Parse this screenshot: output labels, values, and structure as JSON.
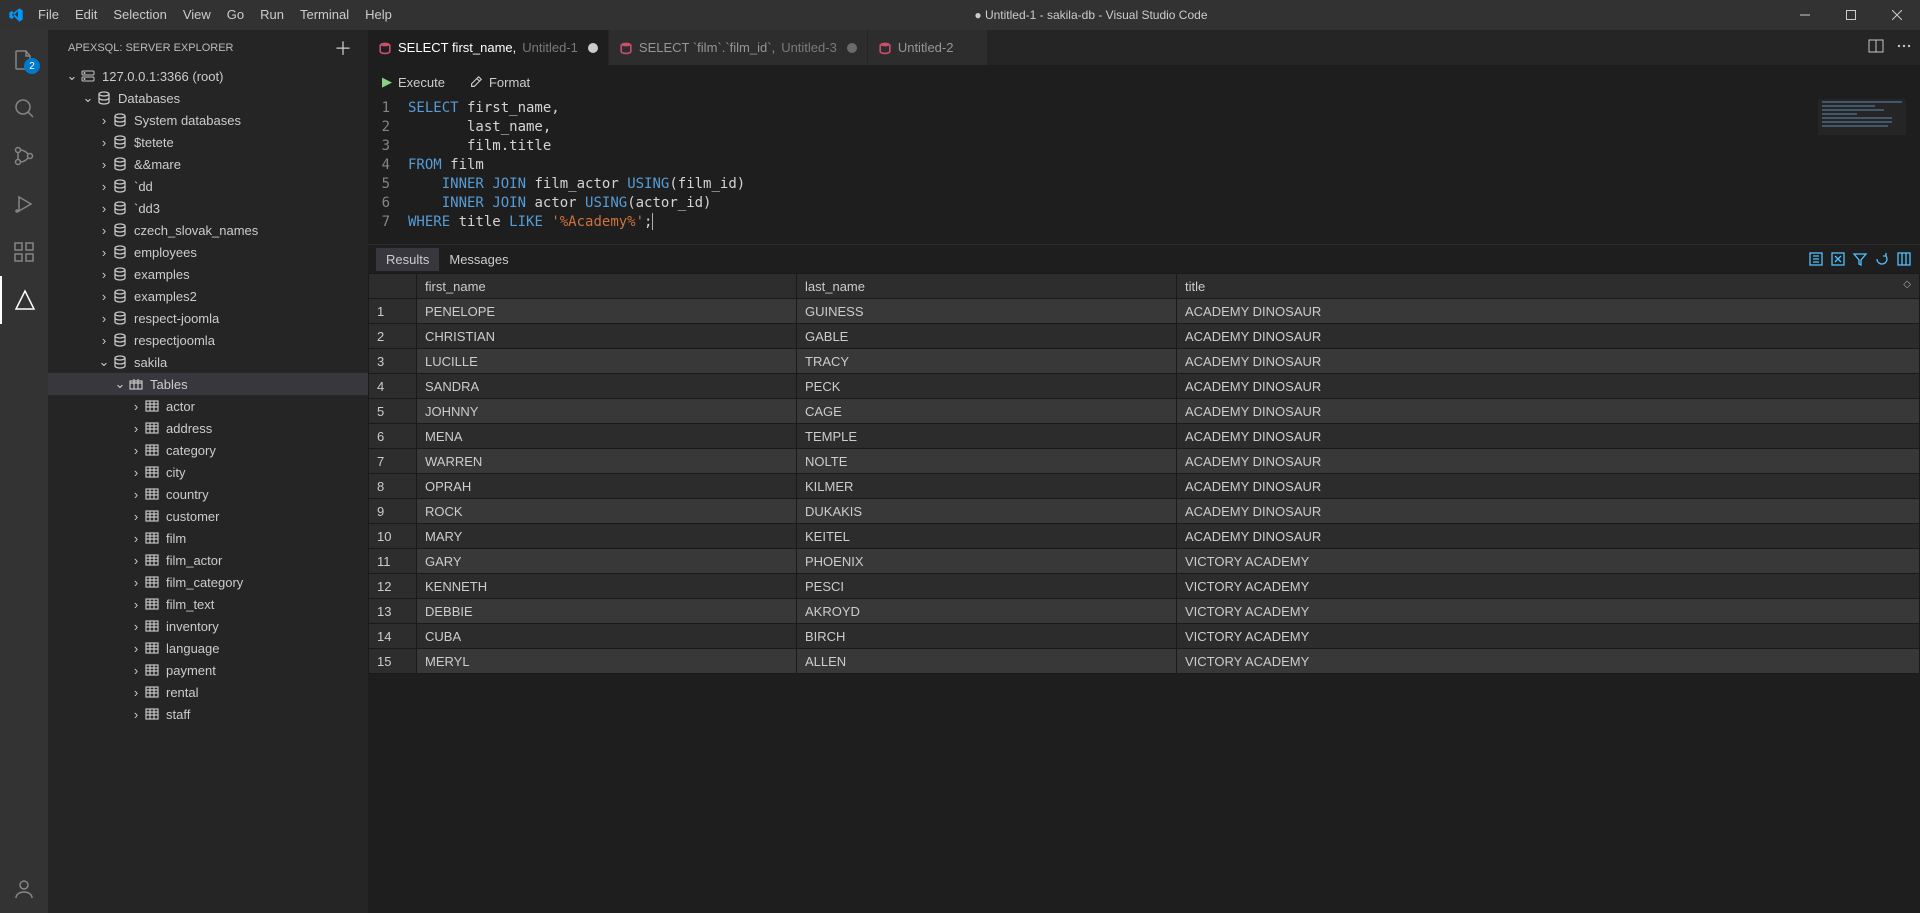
{
  "titlebar": {
    "title": "● Untitled-1 - sakila-db - Visual Studio Code",
    "menus": [
      "File",
      "Edit",
      "Selection",
      "View",
      "Go",
      "Run",
      "Terminal",
      "Help"
    ]
  },
  "activity": {
    "explorer_badge": "2"
  },
  "sidebar": {
    "header": "APEXSQL: SERVER EXPLORER",
    "server": "127.0.0.1:3366 (root)",
    "databases_label": "Databases",
    "system_db_label": "System databases",
    "db_list": [
      "$tetete",
      "&&mare",
      "`dd",
      "`dd3",
      "czech_slovak_names",
      "employees",
      "examples",
      "examples2",
      "respect-joomla",
      "respectjoomla"
    ],
    "sakila_label": "sakila",
    "tables_label": "Tables",
    "table_list": [
      "actor",
      "address",
      "category",
      "city",
      "country",
      "customer",
      "film",
      "film_actor",
      "film_category",
      "film_text",
      "inventory",
      "language",
      "payment",
      "rental",
      "staff"
    ]
  },
  "tabs": [
    {
      "label": "SELECT first_name,",
      "suffix": "Untitled-1",
      "active": true,
      "dirty": true
    },
    {
      "label": "SELECT `film`.`film_id`,",
      "suffix": "Untitled-3",
      "active": false,
      "dirty": true
    },
    {
      "label": "Untitled-2",
      "suffix": "",
      "active": false,
      "dirty": false
    }
  ],
  "toolbar": {
    "execute": "Execute",
    "format": "Format"
  },
  "code": {
    "lines": [
      "1",
      "2",
      "3",
      "4",
      "5",
      "6",
      "7"
    ],
    "tokens": [
      [
        {
          "t": "SELECT",
          "c": "kw"
        },
        {
          "t": " first_name,",
          "c": "id"
        }
      ],
      [
        {
          "t": "       last_name,",
          "c": "id"
        }
      ],
      [
        {
          "t": "       film.title",
          "c": "id"
        }
      ],
      [
        {
          "t": "FROM",
          "c": "kw"
        },
        {
          "t": " film",
          "c": "id"
        }
      ],
      [
        {
          "t": "    ",
          "c": "id"
        },
        {
          "t": "INNER",
          "c": "kw"
        },
        {
          "t": " ",
          "c": "id"
        },
        {
          "t": "JOIN",
          "c": "kw"
        },
        {
          "t": " film_actor ",
          "c": "id"
        },
        {
          "t": "USING",
          "c": "kw"
        },
        {
          "t": "(film_id)",
          "c": "id"
        }
      ],
      [
        {
          "t": "    ",
          "c": "id"
        },
        {
          "t": "INNER",
          "c": "kw"
        },
        {
          "t": " ",
          "c": "id"
        },
        {
          "t": "JOIN",
          "c": "kw"
        },
        {
          "t": " actor ",
          "c": "id"
        },
        {
          "t": "USING",
          "c": "kw"
        },
        {
          "t": "(actor_id)",
          "c": "id"
        }
      ],
      [
        {
          "t": "WHERE",
          "c": "kw"
        },
        {
          "t": " title ",
          "c": "id"
        },
        {
          "t": "LIKE",
          "c": "kw"
        },
        {
          "t": " ",
          "c": "id"
        },
        {
          "t": "'%Academy%'",
          "c": "str"
        },
        {
          "t": ";",
          "c": "id"
        }
      ]
    ]
  },
  "results": {
    "tabs": {
      "results": "Results",
      "messages": "Messages"
    },
    "columns": [
      "first_name",
      "last_name",
      "title"
    ],
    "rows": [
      [
        "PENELOPE",
        "GUINESS",
        "ACADEMY DINOSAUR"
      ],
      [
        "CHRISTIAN",
        "GABLE",
        "ACADEMY DINOSAUR"
      ],
      [
        "LUCILLE",
        "TRACY",
        "ACADEMY DINOSAUR"
      ],
      [
        "SANDRA",
        "PECK",
        "ACADEMY DINOSAUR"
      ],
      [
        "JOHNNY",
        "CAGE",
        "ACADEMY DINOSAUR"
      ],
      [
        "MENA",
        "TEMPLE",
        "ACADEMY DINOSAUR"
      ],
      [
        "WARREN",
        "NOLTE",
        "ACADEMY DINOSAUR"
      ],
      [
        "OPRAH",
        "KILMER",
        "ACADEMY DINOSAUR"
      ],
      [
        "ROCK",
        "DUKAKIS",
        "ACADEMY DINOSAUR"
      ],
      [
        "MARY",
        "KEITEL",
        "ACADEMY DINOSAUR"
      ],
      [
        "GARY",
        "PHOENIX",
        "VICTORY ACADEMY"
      ],
      [
        "KENNETH",
        "PESCI",
        "VICTORY ACADEMY"
      ],
      [
        "DEBBIE",
        "AKROYD",
        "VICTORY ACADEMY"
      ],
      [
        "CUBA",
        "BIRCH",
        "VICTORY ACADEMY"
      ],
      [
        "MERYL",
        "ALLEN",
        "VICTORY ACADEMY"
      ]
    ]
  }
}
